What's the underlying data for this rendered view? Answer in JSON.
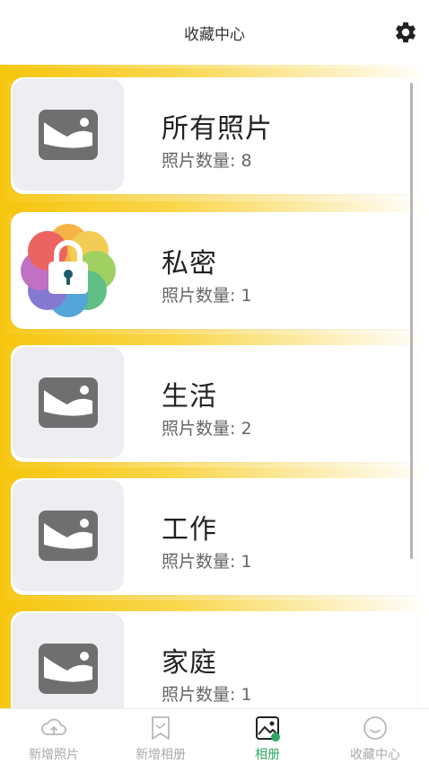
{
  "header": {
    "title": "收藏中心"
  },
  "albums": [
    {
      "name": "所有照片",
      "count_label": "照片数量: 8"
    },
    {
      "name": "私密",
      "count_label": "照片数量: 1"
    },
    {
      "name": "生活",
      "count_label": "照片数量: 2"
    },
    {
      "name": "工作",
      "count_label": "照片数量: 1"
    },
    {
      "name": "家庭",
      "count_label": "照片数量: 1"
    }
  ],
  "tabbar": {
    "tabs": [
      {
        "label": "新增照片",
        "icon": "cloud-upload-icon"
      },
      {
        "label": "新增相册",
        "icon": "bookmark-icon"
      },
      {
        "label": "相册",
        "icon": "album-icon",
        "active": true
      },
      {
        "label": "收藏中心",
        "icon": "smile-icon"
      }
    ]
  },
  "colors": {
    "accent_yellow": "#f6c50d",
    "active_tab": "#2ea862",
    "placeholder_icon": "#6f6f6f"
  }
}
